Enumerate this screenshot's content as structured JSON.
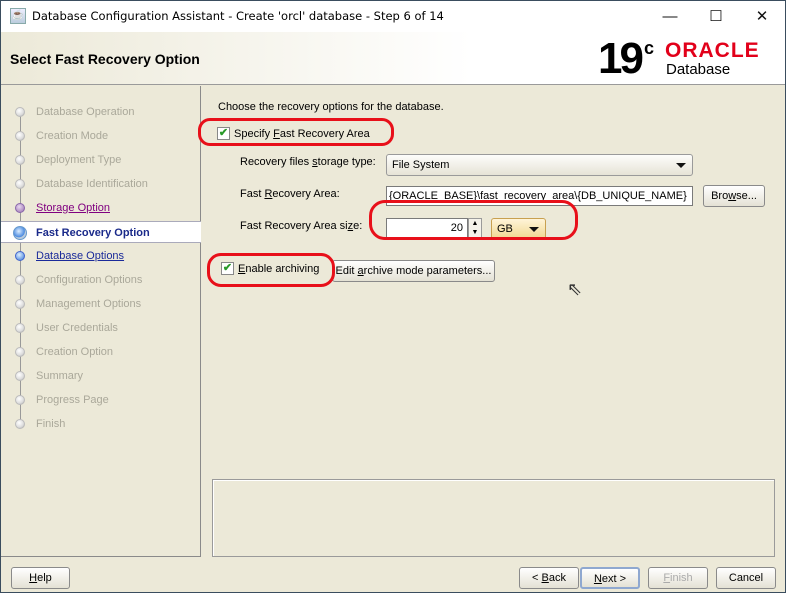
{
  "window": {
    "title": "Database Configuration Assistant - Create 'orcl' database - Step 6 of 14",
    "minimize": "—",
    "maximize": "☐",
    "close": "✕"
  },
  "header": {
    "page_title": "Select Fast Recovery Option",
    "logo": {
      "version": "19",
      "suffix": "c",
      "brand": "ORACLE",
      "product": "Database"
    }
  },
  "nav": {
    "items": [
      {
        "label": "Database Operation",
        "state": "disabled"
      },
      {
        "label": "Creation Mode",
        "state": "disabled"
      },
      {
        "label": "Deployment Type",
        "state": "disabled"
      },
      {
        "label": "Database Identification",
        "state": "disabled"
      },
      {
        "label": "Storage Option",
        "state": "visited"
      },
      {
        "label": "Fast Recovery Option",
        "state": "active"
      },
      {
        "label": "Database Options",
        "state": "link"
      },
      {
        "label": "Configuration Options",
        "state": "disabled"
      },
      {
        "label": "Management Options",
        "state": "disabled"
      },
      {
        "label": "User Credentials",
        "state": "disabled"
      },
      {
        "label": "Creation Option",
        "state": "disabled"
      },
      {
        "label": "Summary",
        "state": "disabled"
      },
      {
        "label": "Progress Page",
        "state": "disabled"
      },
      {
        "label": "Finish",
        "state": "disabled"
      }
    ]
  },
  "main": {
    "instruction": "Choose the recovery options for the database.",
    "specify_fra": {
      "pre": "Specify ",
      "key": "F",
      "post": "ast Recovery Area",
      "checked": true
    },
    "storage_type": {
      "pre": "Recovery files ",
      "key": "s",
      "post": "torage type:",
      "value": "File System"
    },
    "fra_location": {
      "pre": "Fast ",
      "key": "R",
      "post": "ecovery Area:",
      "value": "{ORACLE_BASE}\\fast_recovery_area\\{DB_UNIQUE_NAME}"
    },
    "browse": {
      "pre": "Bro",
      "key": "w",
      "post": "se..."
    },
    "fra_size": {
      "pre": "Fast Recovery Area si",
      "key": "z",
      "post": "e:",
      "value": "20",
      "unit": "GB"
    },
    "enable_archiving": {
      "pre": "",
      "key": "E",
      "post": "nable archiving",
      "checked": true
    },
    "edit_archive": {
      "pre": "Edit ",
      "key": "a",
      "post": "rchive mode parameters..."
    },
    "check_mark": "✔"
  },
  "footer": {
    "help": {
      "key": "H",
      "post": "elp"
    },
    "back": {
      "pre": "< ",
      "key": "B",
      "post": "ack"
    },
    "next": {
      "key": "N",
      "post": "ext >"
    },
    "finish": {
      "key": "F",
      "post": "inish"
    },
    "cancel": "Cancel"
  }
}
